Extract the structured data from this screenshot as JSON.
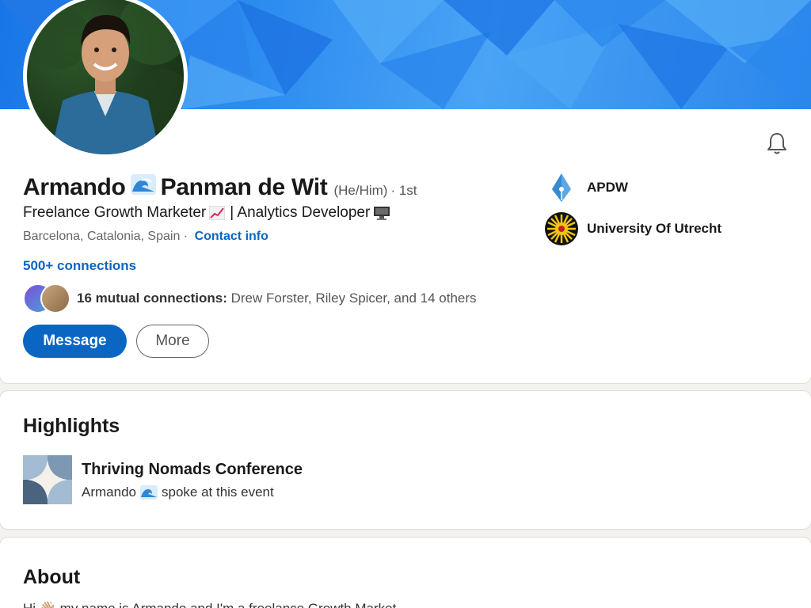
{
  "profile": {
    "first_name": "Armando",
    "last_name": "Panman de Wit",
    "pronouns": "(He/Him)",
    "degree": "· 1st",
    "headline_part1": "Freelance Growth Marketer",
    "headline_part2": "| Analytics Developer",
    "location": "Barcelona, Catalonia, Spain ·",
    "contact_info": "Contact info",
    "connections": "500+ connections",
    "mutual_bold": "16 mutual connections:",
    "mutual_rest": "Drew Forster, Riley Spicer, and 14 others"
  },
  "actions": {
    "message_label": "Message",
    "more_label": "More"
  },
  "organizations": [
    {
      "name": "APDW",
      "icon": "pen-nib-logo"
    },
    {
      "name": "University Of Utrecht",
      "icon": "sun-seal-logo"
    }
  ],
  "highlights": {
    "title": "Highlights",
    "event_title": "Thriving Nomads Conference",
    "event_sub_name": "Armando",
    "event_sub_rest": "spoke at this event"
  },
  "about": {
    "title": "About",
    "text": "Hi 👋🏼 my name is Armando and I'm a freelance Growth Market..."
  },
  "icons": {
    "notification": "bell-icon",
    "wave": "wave-emoji",
    "chart": "chart-increasing-emoji",
    "computer": "desktop-computer-emoji"
  },
  "colors": {
    "accent": "#0a66c2",
    "banner": "#2f8ef0"
  }
}
